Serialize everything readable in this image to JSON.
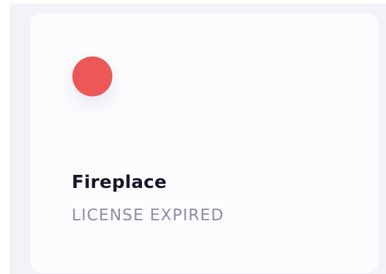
{
  "device_card": {
    "name": "Fireplace",
    "status": "LICENSE EXPIRED",
    "status_icon": "status-dot-icon",
    "status_color": "#ec5757"
  },
  "colors": {
    "background": "#f2f2f8",
    "card": "#fcfcfe",
    "title": "#15162b",
    "subtitle": "#8c8ca8"
  }
}
